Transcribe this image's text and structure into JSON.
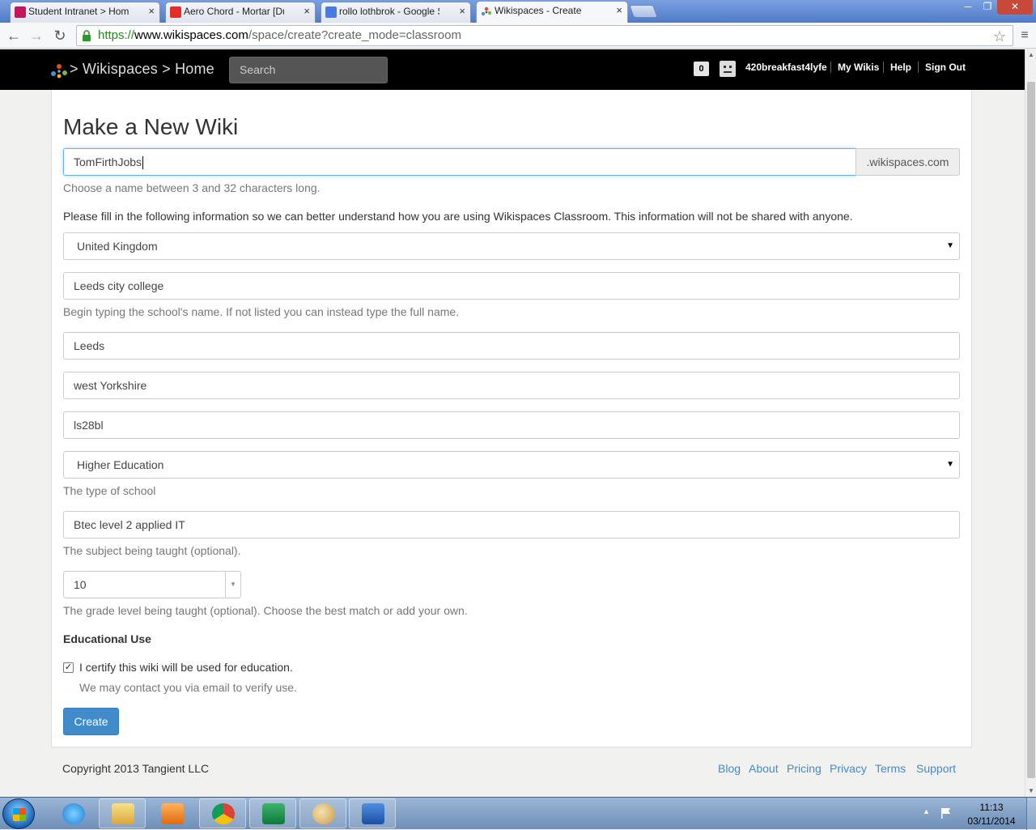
{
  "browser": {
    "tabs": [
      {
        "title": "Student Intranet > Homep",
        "icon_color": "#c2185b"
      },
      {
        "title": "Aero Chord - Mortar [Dub",
        "icon_color": "#e52d27"
      },
      {
        "title": "rollo lothbrok - Google Se",
        "icon_color": "#4a7be0"
      },
      {
        "title": "Wikispaces - Create",
        "icon_color": "#5c7f3a"
      }
    ],
    "close_glyph": "×",
    "url": {
      "scheme": "https://",
      "host": "www.wikispaces.com",
      "path": "/space/create?create_mode=classroom"
    },
    "star_icon": "star-icon"
  },
  "site_header": {
    "breadcrumb_wikispaces": "Wikispaces",
    "breadcrumb_home": "Home",
    "breadcrumb_sep": ">",
    "search_placeholder": "Search",
    "notification_count": "0",
    "username": "420breakfast4lyfe",
    "links": [
      "My Wikis",
      "Help",
      "Sign Out"
    ]
  },
  "form": {
    "title": "Make a New Wiki",
    "wiki_name_value": "TomFirthJobs",
    "domain_suffix": ".wikispaces.com",
    "wiki_name_help": "Choose a name between 3 and 32 characters long.",
    "info_text": "Please fill in the following information so we can better understand how you are using Wikispaces Classroom. This information will not be shared with anyone.",
    "country_value": "United Kingdom",
    "school_value": "Leeds city college",
    "school_help": "Begin typing the school's name. If not listed you can instead type the full name.",
    "city_value": "Leeds",
    "region_value": "west Yorkshire",
    "postcode_value": "ls28bl",
    "school_type_value": "Higher Education",
    "school_type_help": "The type of school",
    "subject_value": "Btec level 2 applied IT",
    "subject_help": "The subject being taught (optional).",
    "grade_value": "10",
    "grade_help": "The grade level being taught (optional). Choose the best match or add your own.",
    "edu_heading": "Educational Use",
    "edu_checked": true,
    "edu_label": "I certify this wiki will be used for education.",
    "edu_note": "We may contact you via email to verify use.",
    "create_label": "Create"
  },
  "footer": {
    "copyright": "Copyright 2013 Tangient LLC",
    "links": [
      "Blog",
      "About",
      "Pricing",
      "Privacy",
      "Terms",
      "Support"
    ]
  },
  "taskbar": {
    "apps": [
      "internet-explorer",
      "file-explorer",
      "media-player",
      "chrome",
      "publisher",
      "paint",
      "word"
    ],
    "time": "11:13",
    "date": "03/11/2014"
  },
  "colors": {
    "primary_button": "#428bca",
    "link": "#428bca",
    "header_bg": "#000000",
    "focus_border": "#66afe9"
  }
}
